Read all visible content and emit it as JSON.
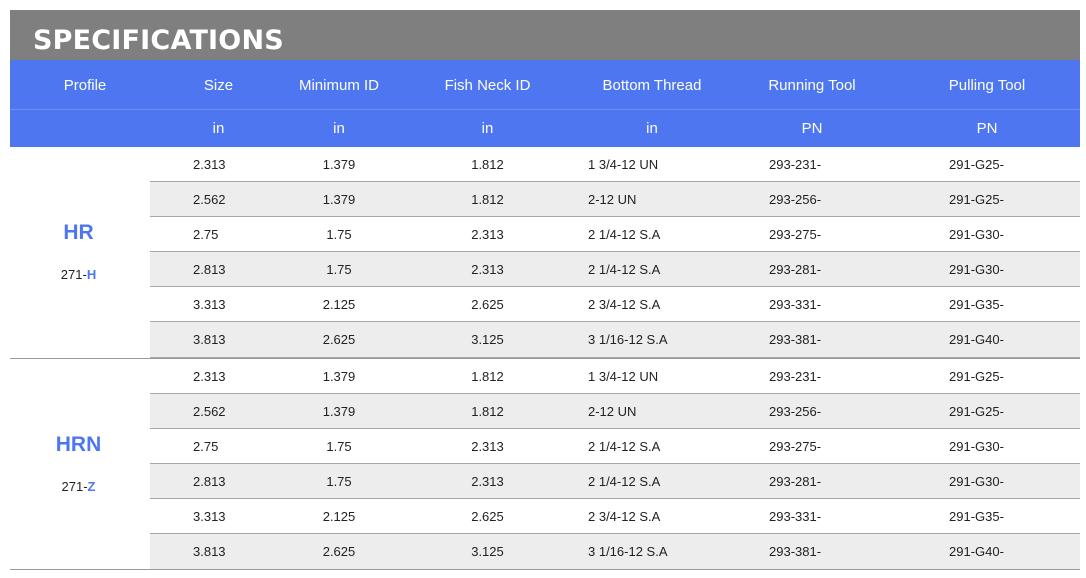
{
  "title": "SPECIFICATIONS",
  "headers": [
    "Profile",
    "Size",
    "Minimum ID",
    "Fish Neck ID",
    "Bottom Thread",
    "Running Tool",
    "Pulling Tool"
  ],
  "units": [
    "",
    "in",
    "in",
    "in",
    "in",
    "PN",
    "PN"
  ],
  "colors": {
    "accent": "#4d76f0",
    "title_bg": "#7f7f7f",
    "shade": "#ededed"
  },
  "groups": [
    {
      "profile": "HR",
      "code_prefix": "271-",
      "code_suffix": "H",
      "rows": [
        [
          "2.313",
          "1.379",
          "1.812",
          "1 3/4-12 UN",
          "293-231-",
          "291-G25-"
        ],
        [
          "2.562",
          "1.379",
          "1.812",
          "2-12 UN",
          "293-256-",
          "291-G25-"
        ],
        [
          "2.75",
          "1.75",
          "2.313",
          "2 1/4-12 S.A",
          "293-275-",
          "291-G30-"
        ],
        [
          "2.813",
          "1.75",
          "2.313",
          "2 1/4-12 S.A",
          "293-281-",
          "291-G30-"
        ],
        [
          "3.313",
          "2.125",
          "2.625",
          "2 3/4-12 S.A",
          "293-331-",
          "291-G35-"
        ],
        [
          "3.813",
          "2.625",
          "3.125",
          "3 1/16-12 S.A",
          "293-381-",
          "291-G40-"
        ]
      ]
    },
    {
      "profile": "HRN",
      "code_prefix": "271-",
      "code_suffix": "Z",
      "rows": [
        [
          "2.313",
          "1.379",
          "1.812",
          "1 3/4-12 UN",
          "293-231-",
          "291-G25-"
        ],
        [
          "2.562",
          "1.379",
          "1.812",
          "2-12 UN",
          "293-256-",
          "291-G25-"
        ],
        [
          "2.75",
          "1.75",
          "2.313",
          "2 1/4-12 S.A",
          "293-275-",
          "291-G30-"
        ],
        [
          "2.813",
          "1.75",
          "2.313",
          "2 1/4-12 S.A",
          "293-281-",
          "291-G30-"
        ],
        [
          "3.313",
          "2.125",
          "2.625",
          "2 3/4-12 S.A",
          "293-331-",
          "291-G35-"
        ],
        [
          "3.813",
          "2.625",
          "3.125",
          "3 1/16-12 S.A",
          "293-381-",
          "291-G40-"
        ]
      ]
    }
  ]
}
